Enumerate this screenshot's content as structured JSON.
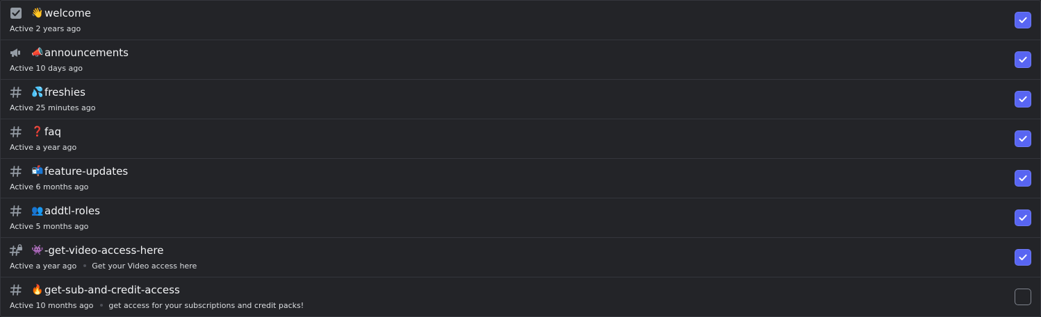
{
  "colors": {
    "background": "#232428",
    "border": "#34363c",
    "text_primary": "#f2f3f5",
    "text_secondary": "#dbdee1",
    "icon_muted": "#949ba4",
    "checkbox_checked": "#5865f2",
    "checkbox_unchecked_border": "#80848e"
  },
  "channels": [
    {
      "icon": "rules-checkbox-icon",
      "emoji": "👋",
      "name": "welcome",
      "activity": "Active 2 years ago",
      "topic": "",
      "checked": true
    },
    {
      "icon": "megaphone-icon",
      "emoji": "📣",
      "name": "announcements",
      "activity": "Active 10 days ago",
      "topic": "",
      "checked": true
    },
    {
      "icon": "hashtag-icon",
      "emoji": "💦",
      "name": "freshies",
      "activity": "Active 25 minutes ago",
      "topic": "",
      "checked": true
    },
    {
      "icon": "hashtag-icon",
      "emoji": "❓",
      "name": "faq",
      "activity": "Active a year ago",
      "topic": "",
      "checked": true
    },
    {
      "icon": "hashtag-icon",
      "emoji": "📬",
      "name": "feature-updates",
      "activity": "Active 6 months ago",
      "topic": "",
      "checked": true
    },
    {
      "icon": "hashtag-icon",
      "emoji": "👥",
      "name": "addtl-roles",
      "activity": "Active 5 months ago",
      "topic": "",
      "checked": true
    },
    {
      "icon": "hashtag-lock-icon",
      "emoji": "👾",
      "name": "-get-video-access-here",
      "activity": "Active a year ago",
      "topic": "Get your Video access here",
      "checked": true
    },
    {
      "icon": "hashtag-icon",
      "emoji": "🔥",
      "name": "get-sub-and-credit-access",
      "activity": "Active 10 months ago",
      "topic": "get access for your subscriptions and credit packs!",
      "checked": false
    }
  ]
}
